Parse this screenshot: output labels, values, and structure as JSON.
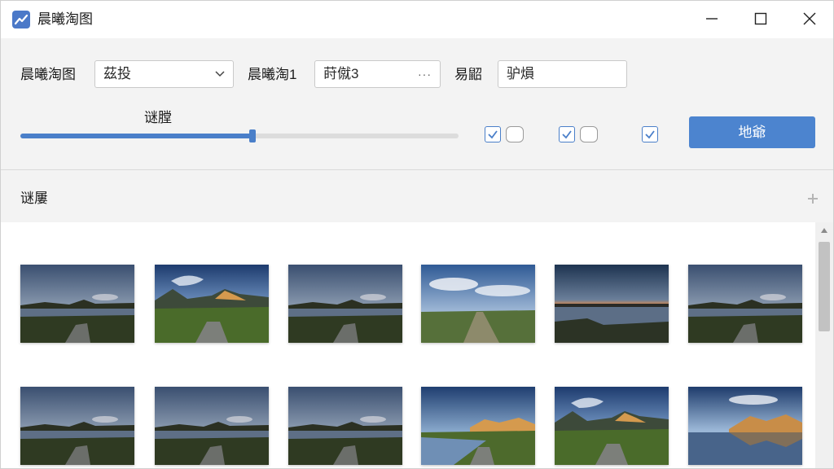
{
  "window": {
    "title": "晨曦淘图",
    "accent_color": "#4c84cf",
    "icons": {
      "app": "chart-line-icon",
      "minimize": "minimize-icon",
      "maximize": "maximize-icon",
      "close": "close-icon"
    }
  },
  "toolbar": {
    "field1_label": "晨曦淘图",
    "field1_value": "茲投",
    "field2_label": "晨曦淘1",
    "field2_value": "莳僦3",
    "field2_suffix": "···",
    "field3_label": "易鼦",
    "field3_value": "驴熉",
    "slider_label": "谜膛",
    "slider_value": 0.53,
    "checkbox_groups": [
      {
        "checked": true,
        "toggle_on": false
      },
      {
        "checked": true,
        "toggle_on": false
      },
      {
        "checked": true
      }
    ],
    "primary_button_label": "地爺"
  },
  "gallery": {
    "section_title": "谜屢",
    "add_icon": "plus-icon",
    "rows": [
      [
        "sunset-lake",
        "mountain-meadow",
        "sunset-lake",
        "cloudy-field",
        "dusk-reflection",
        "sunset-lake"
      ],
      [
        "sunset-lake",
        "sunset-lake",
        "sunset-lake",
        "mountain-river",
        "mountain-meadow",
        "mountain-reflection"
      ]
    ]
  }
}
